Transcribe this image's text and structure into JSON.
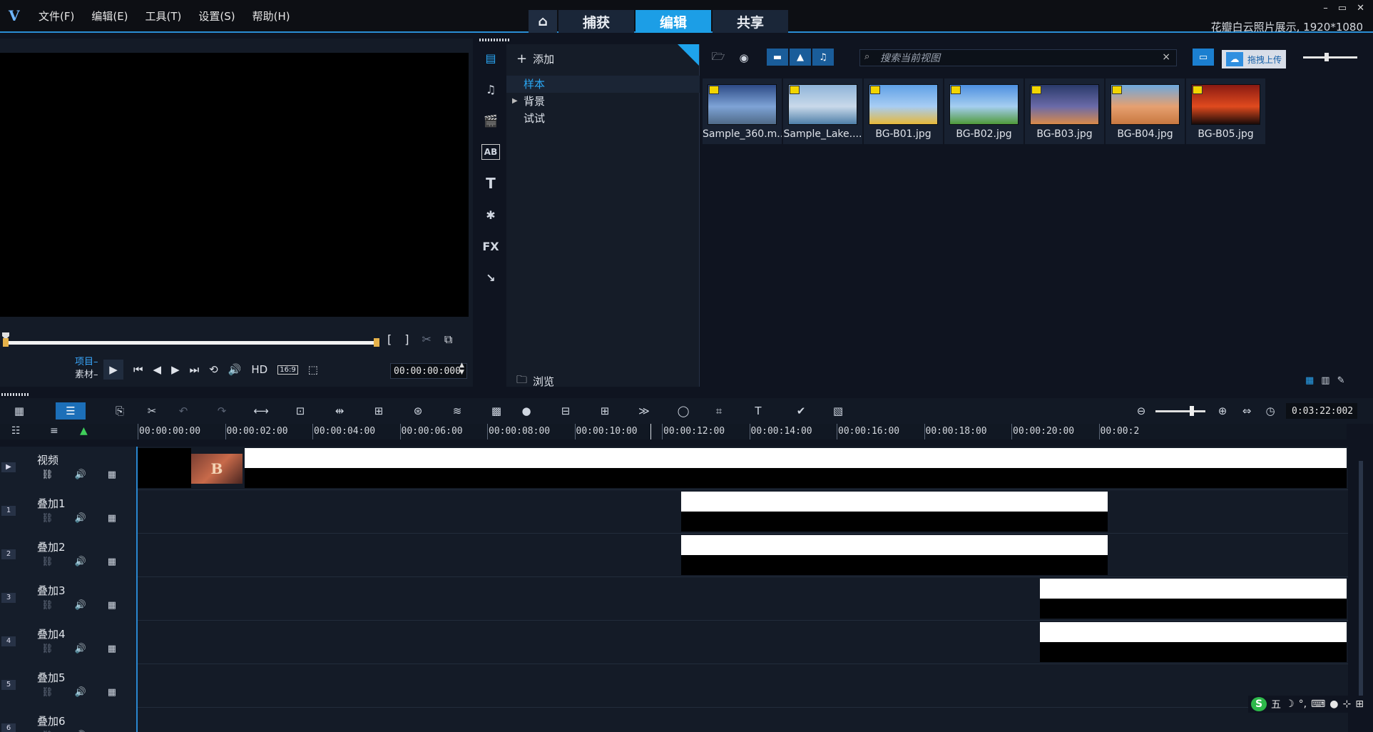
{
  "titlebar": {
    "menu": [
      "文件(F)",
      "编辑(E)",
      "工具(T)",
      "设置(S)",
      "帮助(H)"
    ],
    "tabs": [
      "捕获",
      "编辑",
      "共享"
    ],
    "active_tab": "编辑",
    "project_info": "花瓣白云照片展示, 1920*1080",
    "window_buttons": [
      "–",
      "▭",
      "✕"
    ]
  },
  "preview": {
    "mode_project": "项目–",
    "mode_clip": "素材–",
    "hd_label": "HD",
    "aspect_label": "16:9",
    "timecode": "00:00:00:000",
    "mark_in": "[",
    "mark_out": "]"
  },
  "library": {
    "add_label": "添加",
    "folders": [
      {
        "label": "样本",
        "active": true,
        "expandable": false
      },
      {
        "label": "背景",
        "active": false,
        "expandable": true
      },
      {
        "label": "试试",
        "active": false,
        "expandable": false
      }
    ],
    "browse_label": "浏览",
    "search_placeholder": "搜索当前视图",
    "upload_label": "拖拽上传",
    "side_icons": [
      "media-icon",
      "audio-icon",
      "instant-project-icon",
      "transition-icon",
      "title-icon",
      "graphics-icon",
      "fx-icon",
      "path-icon"
    ],
    "fx_text": "FX",
    "media": [
      {
        "name": "Sample_360.m...",
        "colors": [
          "#2d4a86",
          "#7ea3d6",
          "#4f6a88"
        ]
      },
      {
        "name": "Sample_Lake....",
        "colors": [
          "#8fb4d9",
          "#c9d9ea",
          "#4f7fa8"
        ]
      },
      {
        "name": "BG-B01.jpg",
        "colors": [
          "#5fa0e6",
          "#a8cdf3",
          "#e7b93a"
        ]
      },
      {
        "name": "BG-B02.jpg",
        "colors": [
          "#4d8fe0",
          "#a5cef0",
          "#4f9a3a"
        ]
      },
      {
        "name": "BG-B03.jpg",
        "colors": [
          "#2a3a6a",
          "#6a6aa8",
          "#d98a4a"
        ]
      },
      {
        "name": "BG-B04.jpg",
        "colors": [
          "#6da8dd",
          "#e6a070",
          "#c87840"
        ]
      },
      {
        "name": "BG-B05.jpg",
        "colors": [
          "#8a1a12",
          "#e04a1e",
          "#1a0a08"
        ]
      }
    ]
  },
  "timeline": {
    "duration": "0:03:22:002",
    "ruler": [
      "00:00:00:00",
      "00:00:02:00",
      "00:00:04:00",
      "00:00:06:00",
      "00:00:08:00",
      "00:00:10:00",
      "00:00:12:00",
      "00:00:14:00",
      "00:00:16:00",
      "00:00:18:00",
      "00:00:20:00",
      "00:00:2"
    ],
    "tracks": [
      {
        "name": "视频",
        "num": "▶"
      },
      {
        "name": "叠加1",
        "num": "1"
      },
      {
        "name": "叠加2",
        "num": "2"
      },
      {
        "name": "叠加3",
        "num": "3"
      },
      {
        "name": "叠加4",
        "num": "4"
      },
      {
        "name": "叠加5",
        "num": "5"
      },
      {
        "name": "叠加6",
        "num": "6"
      }
    ],
    "clip_letter": "B"
  },
  "ime": {
    "logo": "S",
    "label": "五"
  }
}
